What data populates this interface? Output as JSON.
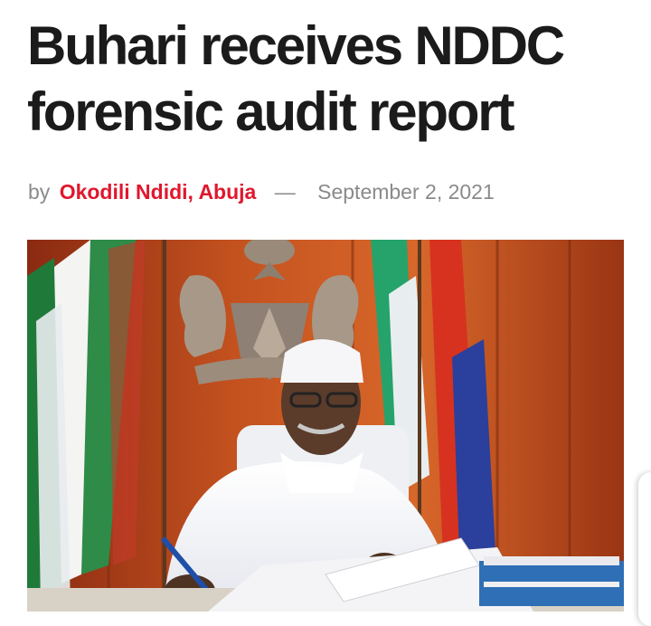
{
  "article": {
    "title": "Buhari receives NDDC forensic audit report",
    "byline_prefix": "by",
    "author": "Okodili Ndidi, Abuja",
    "separator": "—",
    "date": "September 2, 2021"
  },
  "colors": {
    "headline": "#1b1b1b",
    "author_link": "#e0172d",
    "meta_text": "#8a8a8a"
  },
  "photo": {
    "icon": "news-photo"
  }
}
